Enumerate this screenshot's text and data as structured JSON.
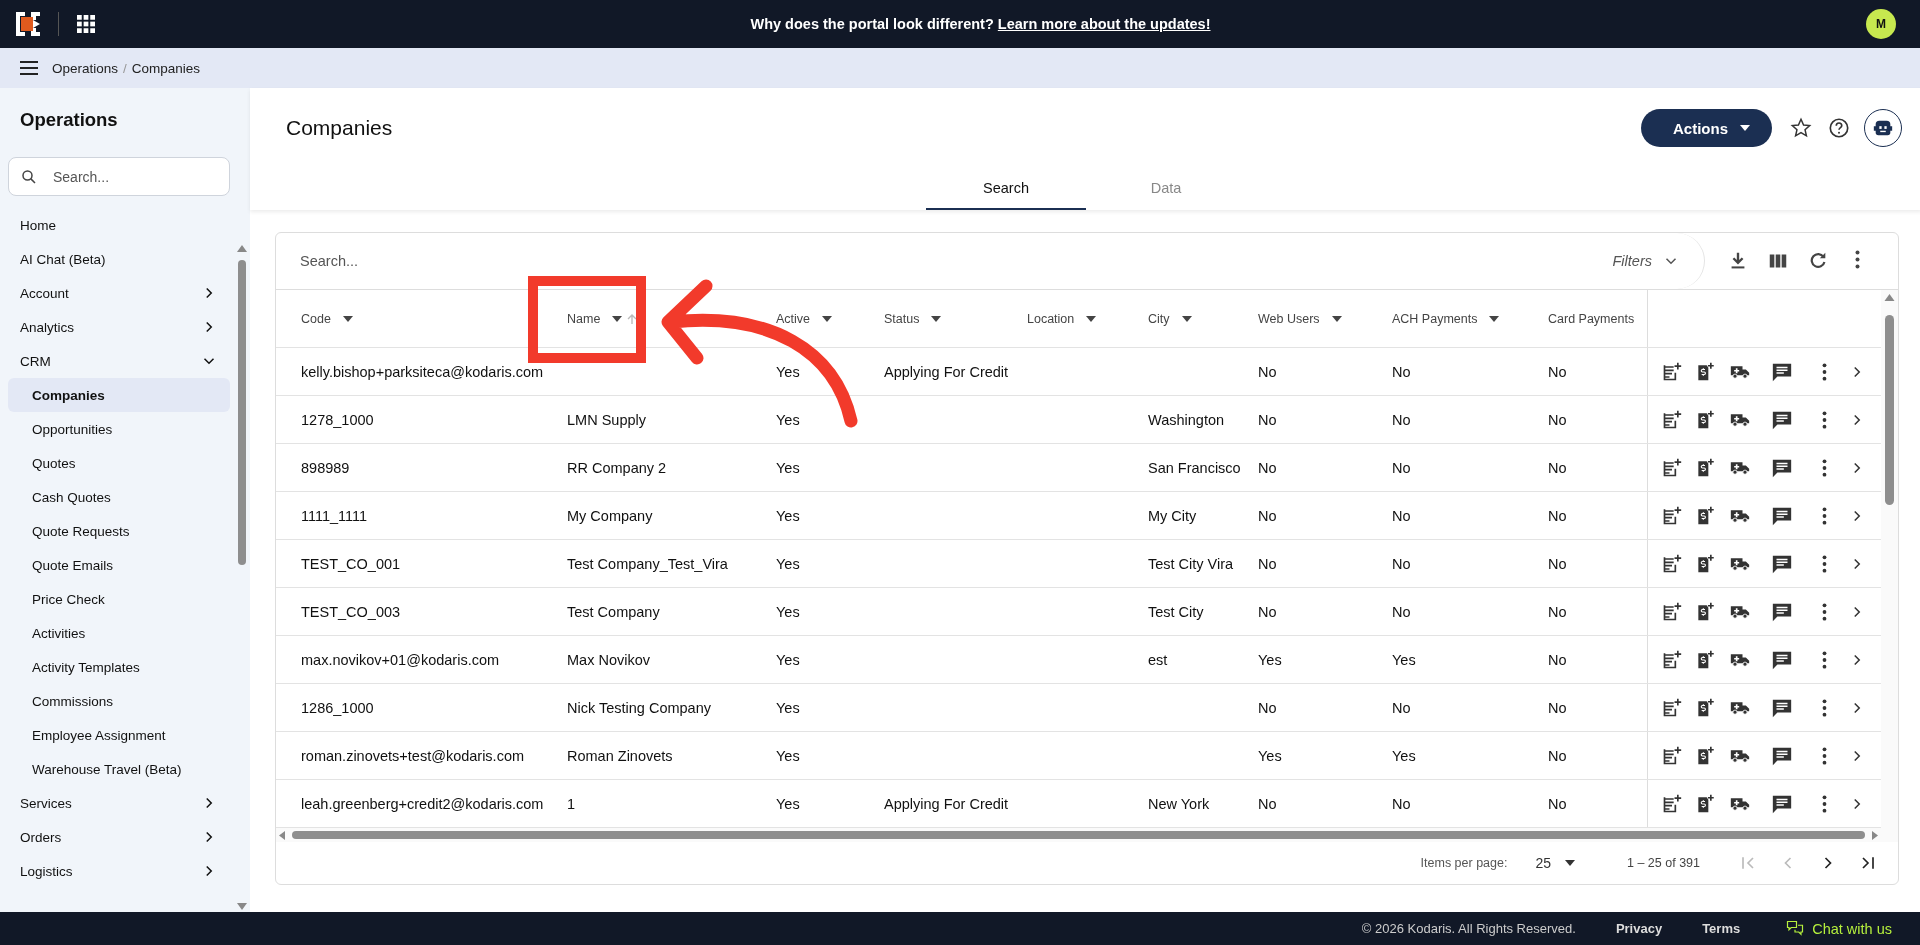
{
  "top_bar": {
    "banner_text": "Why does the portal look different?",
    "banner_link": "Learn more about the updates!",
    "avatar": "M"
  },
  "breadcrumb": {
    "items": [
      "Operations",
      "Companies"
    ],
    "separator": "/"
  },
  "sidebar": {
    "title": "Operations",
    "search": {
      "placeholder": "Search..."
    },
    "items": [
      {
        "label": "Home",
        "kind": "link",
        "selected": false
      },
      {
        "label": "AI Chat (Beta)",
        "kind": "link",
        "selected": false
      },
      {
        "label": "Account",
        "kind": "group",
        "selected": false,
        "expanded": false
      },
      {
        "label": "Analytics",
        "kind": "group",
        "selected": false,
        "expanded": false
      },
      {
        "label": "CRM",
        "kind": "group",
        "selected": false,
        "expanded": true,
        "children": [
          {
            "label": "Companies",
            "kind": "link",
            "selected": true
          },
          {
            "label": "Opportunities",
            "kind": "link",
            "selected": false
          },
          {
            "label": "Quotes",
            "kind": "link",
            "selected": false
          },
          {
            "label": "Cash Quotes",
            "kind": "link",
            "selected": false
          },
          {
            "label": "Quote Requests",
            "kind": "link",
            "selected": false
          },
          {
            "label": "Quote Emails",
            "kind": "link",
            "selected": false
          },
          {
            "label": "Price Check",
            "kind": "link",
            "selected": false
          },
          {
            "label": "Activities",
            "kind": "link",
            "selected": false
          },
          {
            "label": "Activity Templates",
            "kind": "link",
            "selected": false
          },
          {
            "label": "Commissions",
            "kind": "link",
            "selected": false
          },
          {
            "label": "Employee Assignment",
            "kind": "link",
            "selected": false
          },
          {
            "label": "Warehouse Travel (Beta)",
            "kind": "link",
            "selected": false
          }
        ]
      },
      {
        "label": "Services",
        "kind": "group",
        "selected": false,
        "expanded": false
      },
      {
        "label": "Orders",
        "kind": "group",
        "selected": false,
        "expanded": false
      },
      {
        "label": "Logistics",
        "kind": "group",
        "selected": false,
        "expanded": false
      }
    ]
  },
  "page": {
    "title": "Companies",
    "actions_button": "Actions",
    "tabs": [
      {
        "label": "Search",
        "selected": true
      },
      {
        "label": "Data",
        "selected": false
      }
    ]
  },
  "table": {
    "search": {
      "placeholder": "Search..."
    },
    "filters_label": "Filters",
    "columns": [
      {
        "label": "Code",
        "sortable": true
      },
      {
        "label": "Name",
        "sortable": true,
        "sort_hint": true
      },
      {
        "label": "Active",
        "sortable": true
      },
      {
        "label": "Status",
        "sortable": true
      },
      {
        "label": "Location",
        "sortable": true
      },
      {
        "label": "City",
        "sortable": true
      },
      {
        "label": "Web Users",
        "sortable": true
      },
      {
        "label": "ACH Payments",
        "sortable": true
      },
      {
        "label": "Card Payments",
        "sortable": false
      }
    ],
    "rows": [
      {
        "code": "kelly.bishop+parksiteca@kodaris.com",
        "active": "Yes",
        "status": "Applying For Credit",
        "web_users": "No",
        "ach_payments": "No",
        "card_payments": "No"
      },
      {
        "code": "1278_1000",
        "name": "LMN Supply",
        "active": "Yes",
        "city": "Washington",
        "web_users": "No",
        "ach_payments": "No",
        "card_payments": "No"
      },
      {
        "code": "898989",
        "name": "RR Company 2",
        "active": "Yes",
        "city": "San Francisco",
        "web_users": "No",
        "ach_payments": "No",
        "card_payments": "No"
      },
      {
        "code": "1111_1111",
        "name": "My Company",
        "active": "Yes",
        "city": "My City",
        "web_users": "No",
        "ach_payments": "No",
        "card_payments": "No"
      },
      {
        "code": "TEST_CO_001",
        "name": "Test Company_Test_Vira",
        "active": "Yes",
        "city": "Test City Vira",
        "web_users": "No",
        "ach_payments": "No",
        "card_payments": "No"
      },
      {
        "code": "TEST_CO_003",
        "name": "Test Company",
        "active": "Yes",
        "city": "Test City",
        "web_users": "No",
        "ach_payments": "No",
        "card_payments": "No"
      },
      {
        "code": "max.novikov+01@kodaris.com",
        "name": "Max Novikov",
        "active": "Yes",
        "city": "est",
        "web_users": "Yes",
        "ach_payments": "Yes",
        "card_payments": "No"
      },
      {
        "code": "1286_1000",
        "name": "Nick Testing Company",
        "active": "Yes",
        "web_users": "No",
        "ach_payments": "No",
        "card_payments": "No"
      },
      {
        "code": "roman.zinovets+test@kodaris.com",
        "name": "Roman Zinovets",
        "active": "Yes",
        "web_users": "Yes",
        "ach_payments": "Yes",
        "card_payments": "No"
      },
      {
        "code": "leah.greenberg+credit2@kodaris.com",
        "name": "1",
        "active": "Yes",
        "status": "Applying For Credit",
        "city": "New York",
        "web_users": "No",
        "ach_payments": "No",
        "card_payments": "No"
      }
    ]
  },
  "paginator": {
    "items_per_page_label": "Items per page:",
    "page_size": "25",
    "range": "1 – 25 of 391",
    "buttons": [
      {
        "kind": "first",
        "disabled": true
      },
      {
        "kind": "prev",
        "disabled": true
      },
      {
        "kind": "next",
        "disabled": false
      },
      {
        "kind": "last",
        "disabled": false
      }
    ]
  },
  "footer": {
    "copyright": "© 2026 Kodaris. All Rights Reserved.",
    "links": [
      "Privacy",
      "Terms"
    ],
    "chat": "Chat with us"
  }
}
